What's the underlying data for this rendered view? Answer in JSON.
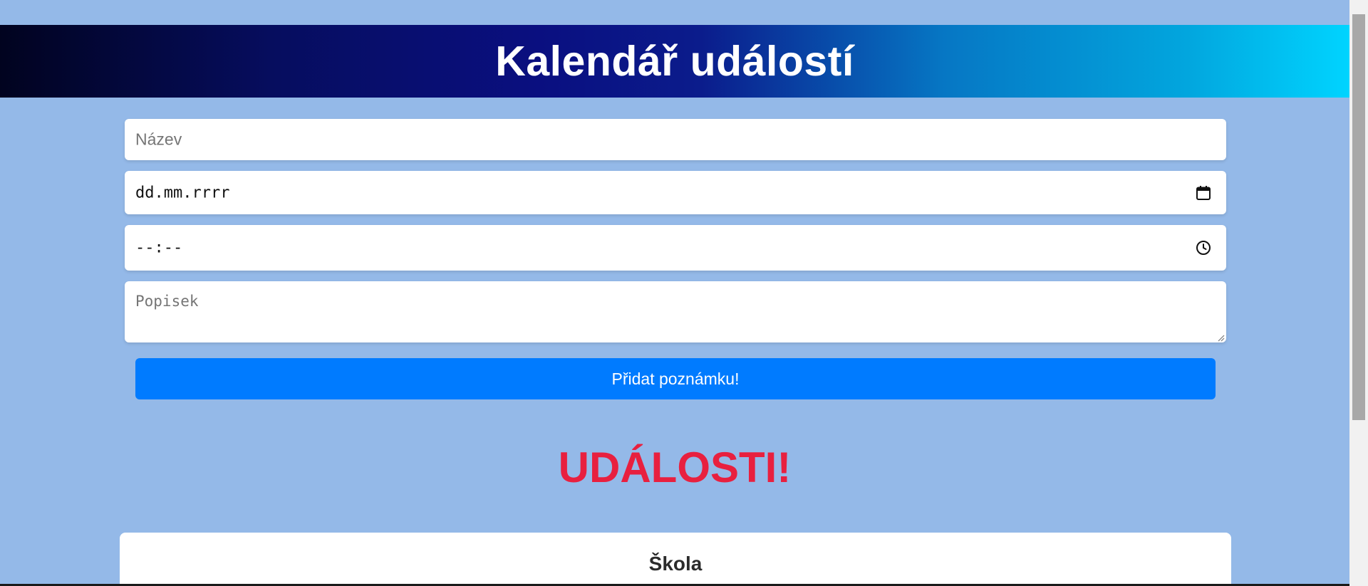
{
  "header": {
    "title": "Kalendář událostí"
  },
  "form": {
    "name_placeholder": "Název",
    "date_value": "dd.mm.rrrr",
    "time_value": "--:--",
    "description_placeholder": "Popisek",
    "submit_label": "Přidat poznámku!",
    "icons": {
      "date": "calendar-icon",
      "time": "clock-icon"
    }
  },
  "events": {
    "heading": "UDÁLOSTI!",
    "items": [
      {
        "title": "Škola"
      }
    ]
  },
  "colors": {
    "background": "#94b9e8",
    "button": "#007bff",
    "heading_accent": "#e8203f",
    "header_gradient_start": "#01031f",
    "header_gradient_end": "#00d4ff"
  }
}
